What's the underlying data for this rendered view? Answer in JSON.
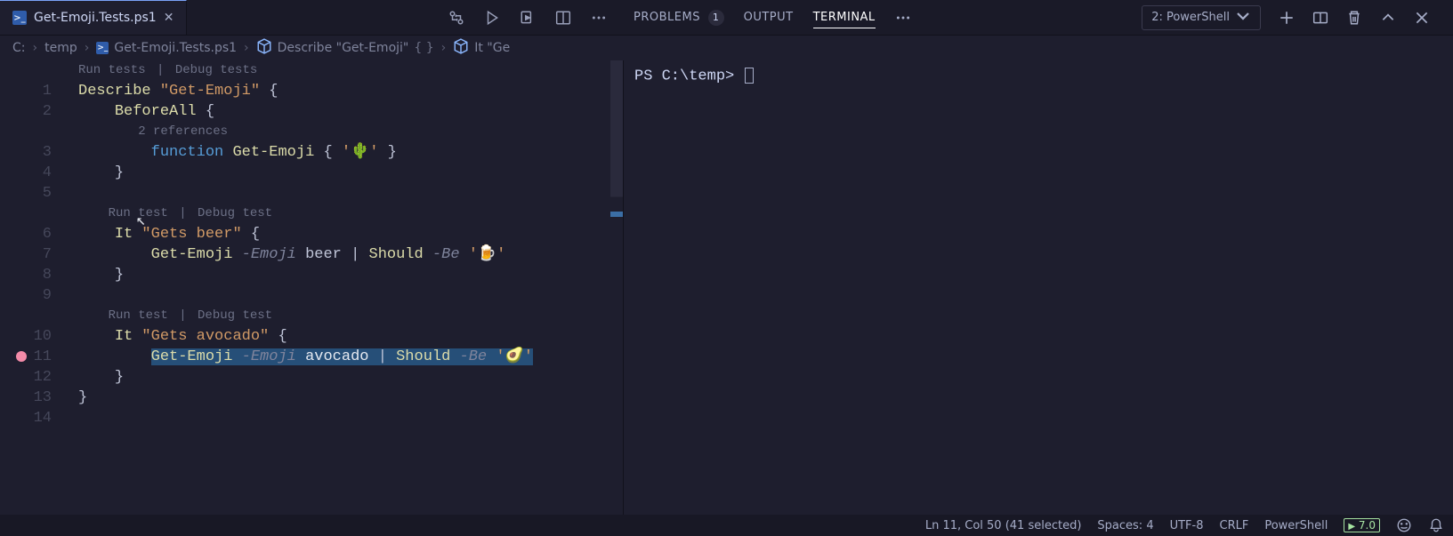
{
  "tab": {
    "filename": "Get-Emoji.Tests.ps1"
  },
  "editor_actions": {},
  "panel": {
    "problems_label": "PROBLEMS",
    "problems_count": "1",
    "output_label": "OUTPUT",
    "terminal_label": "TERMINAL"
  },
  "terminal_picker": {
    "label": "2: PowerShell"
  },
  "breadcrumbs": {
    "seg1": "C:",
    "seg2": "temp",
    "seg3": "Get-Emoji.Tests.ps1",
    "seg4": "Describe \"Get-Emoji\"",
    "brace": "{ }",
    "seg5": "It \"Ge"
  },
  "codelens": {
    "run_tests": "Run tests",
    "debug_tests": "Debug tests",
    "refs": "2 references",
    "run_test": "Run test",
    "debug_test": "Debug test",
    "sep": " | "
  },
  "lines": {
    "n1": "1",
    "n2": "2",
    "n3": "3",
    "n4": "4",
    "n5": "5",
    "n6": "6",
    "n7": "7",
    "n8": "8",
    "n9": "9",
    "n10": "10",
    "n11": "11",
    "n12": "12",
    "n13": "13",
    "n14": "14"
  },
  "code": {
    "describe": "Describe",
    "describe_name": "\"Get-Emoji\"",
    "open": " {",
    "beforeall": "BeforeAll",
    "beforeall_open": " {",
    "function_kw": "function",
    "func_name": "Get-Emoji",
    "func_body_open": " { ",
    "cactus": "'🌵'",
    "func_body_close": " }",
    "close_brace": "}",
    "it": "It",
    "it1_name": "\"Gets beer\"",
    "it1_open": " {",
    "call1_cmd": "Get-Emoji",
    "call1_param": " -Emoji",
    "call1_arg": " beer ",
    "pipe": "|",
    "should": " Should",
    "be": " -Be ",
    "beer": "'🍺'",
    "it2_name": "\"Gets avocado\"",
    "it2_open": " {",
    "call2_arg": " avocado ",
    "avocado": "'🥑'"
  },
  "terminal": {
    "prompt": "PS C:\\temp> "
  },
  "status": {
    "pos": "Ln 11, Col 50 (41 selected)",
    "spaces": "Spaces: 4",
    "encoding": "UTF-8",
    "eol": "CRLF",
    "lang": "PowerShell",
    "version": "7.0"
  }
}
